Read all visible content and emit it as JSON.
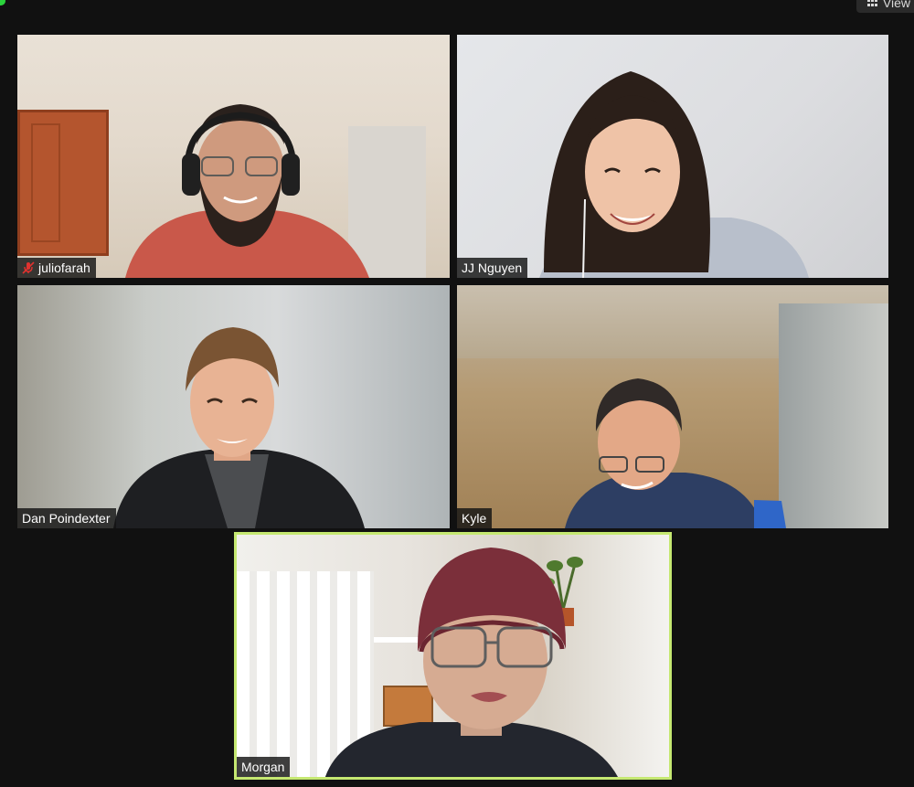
{
  "app": {
    "view_label": "View"
  },
  "participants": [
    {
      "name": "juliofarah",
      "muted": true,
      "active_speaker": false
    },
    {
      "name": "JJ Nguyen",
      "muted": false,
      "active_speaker": false
    },
    {
      "name": "Dan Poindexter",
      "muted": false,
      "active_speaker": false
    },
    {
      "name": "Kyle",
      "muted": false,
      "active_speaker": false
    },
    {
      "name": "Morgan",
      "muted": false,
      "active_speaker": true
    }
  ],
  "icons": {
    "view": "grid-icon",
    "mute": "mic-muted-icon",
    "status": "status-dot-icon"
  },
  "colors": {
    "background": "#111111",
    "active_speaker_border": "#c5e871",
    "mute_icon": "#e0322f",
    "status_dot": "#2bd43c"
  }
}
